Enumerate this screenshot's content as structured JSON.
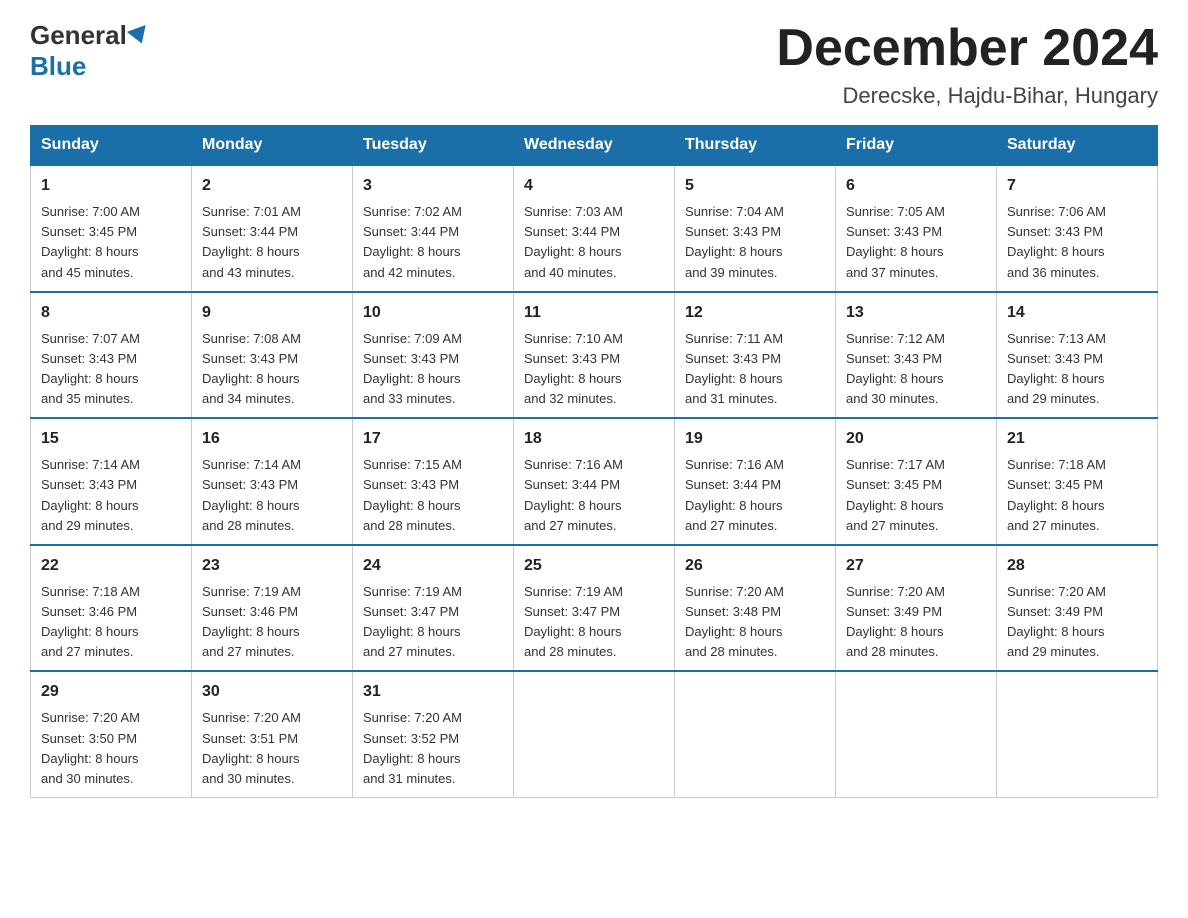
{
  "header": {
    "logo_general": "General",
    "logo_blue": "Blue",
    "title": "December 2024",
    "location": "Derecske, Hajdu-Bihar, Hungary"
  },
  "days_of_week": [
    "Sunday",
    "Monday",
    "Tuesday",
    "Wednesday",
    "Thursday",
    "Friday",
    "Saturday"
  ],
  "weeks": [
    [
      {
        "day": "1",
        "sunrise": "7:00 AM",
        "sunset": "3:45 PM",
        "daylight": "8 hours and 45 minutes."
      },
      {
        "day": "2",
        "sunrise": "7:01 AM",
        "sunset": "3:44 PM",
        "daylight": "8 hours and 43 minutes."
      },
      {
        "day": "3",
        "sunrise": "7:02 AM",
        "sunset": "3:44 PM",
        "daylight": "8 hours and 42 minutes."
      },
      {
        "day": "4",
        "sunrise": "7:03 AM",
        "sunset": "3:44 PM",
        "daylight": "8 hours and 40 minutes."
      },
      {
        "day": "5",
        "sunrise": "7:04 AM",
        "sunset": "3:43 PM",
        "daylight": "8 hours and 39 minutes."
      },
      {
        "day": "6",
        "sunrise": "7:05 AM",
        "sunset": "3:43 PM",
        "daylight": "8 hours and 37 minutes."
      },
      {
        "day": "7",
        "sunrise": "7:06 AM",
        "sunset": "3:43 PM",
        "daylight": "8 hours and 36 minutes."
      }
    ],
    [
      {
        "day": "8",
        "sunrise": "7:07 AM",
        "sunset": "3:43 PM",
        "daylight": "8 hours and 35 minutes."
      },
      {
        "day": "9",
        "sunrise": "7:08 AM",
        "sunset": "3:43 PM",
        "daylight": "8 hours and 34 minutes."
      },
      {
        "day": "10",
        "sunrise": "7:09 AM",
        "sunset": "3:43 PM",
        "daylight": "8 hours and 33 minutes."
      },
      {
        "day": "11",
        "sunrise": "7:10 AM",
        "sunset": "3:43 PM",
        "daylight": "8 hours and 32 minutes."
      },
      {
        "day": "12",
        "sunrise": "7:11 AM",
        "sunset": "3:43 PM",
        "daylight": "8 hours and 31 minutes."
      },
      {
        "day": "13",
        "sunrise": "7:12 AM",
        "sunset": "3:43 PM",
        "daylight": "8 hours and 30 minutes."
      },
      {
        "day": "14",
        "sunrise": "7:13 AM",
        "sunset": "3:43 PM",
        "daylight": "8 hours and 29 minutes."
      }
    ],
    [
      {
        "day": "15",
        "sunrise": "7:14 AM",
        "sunset": "3:43 PM",
        "daylight": "8 hours and 29 minutes."
      },
      {
        "day": "16",
        "sunrise": "7:14 AM",
        "sunset": "3:43 PM",
        "daylight": "8 hours and 28 minutes."
      },
      {
        "day": "17",
        "sunrise": "7:15 AM",
        "sunset": "3:43 PM",
        "daylight": "8 hours and 28 minutes."
      },
      {
        "day": "18",
        "sunrise": "7:16 AM",
        "sunset": "3:44 PM",
        "daylight": "8 hours and 27 minutes."
      },
      {
        "day": "19",
        "sunrise": "7:16 AM",
        "sunset": "3:44 PM",
        "daylight": "8 hours and 27 minutes."
      },
      {
        "day": "20",
        "sunrise": "7:17 AM",
        "sunset": "3:45 PM",
        "daylight": "8 hours and 27 minutes."
      },
      {
        "day": "21",
        "sunrise": "7:18 AM",
        "sunset": "3:45 PM",
        "daylight": "8 hours and 27 minutes."
      }
    ],
    [
      {
        "day": "22",
        "sunrise": "7:18 AM",
        "sunset": "3:46 PM",
        "daylight": "8 hours and 27 minutes."
      },
      {
        "day": "23",
        "sunrise": "7:19 AM",
        "sunset": "3:46 PM",
        "daylight": "8 hours and 27 minutes."
      },
      {
        "day": "24",
        "sunrise": "7:19 AM",
        "sunset": "3:47 PM",
        "daylight": "8 hours and 27 minutes."
      },
      {
        "day": "25",
        "sunrise": "7:19 AM",
        "sunset": "3:47 PM",
        "daylight": "8 hours and 28 minutes."
      },
      {
        "day": "26",
        "sunrise": "7:20 AM",
        "sunset": "3:48 PM",
        "daylight": "8 hours and 28 minutes."
      },
      {
        "day": "27",
        "sunrise": "7:20 AM",
        "sunset": "3:49 PM",
        "daylight": "8 hours and 28 minutes."
      },
      {
        "day": "28",
        "sunrise": "7:20 AM",
        "sunset": "3:49 PM",
        "daylight": "8 hours and 29 minutes."
      }
    ],
    [
      {
        "day": "29",
        "sunrise": "7:20 AM",
        "sunset": "3:50 PM",
        "daylight": "8 hours and 30 minutes."
      },
      {
        "day": "30",
        "sunrise": "7:20 AM",
        "sunset": "3:51 PM",
        "daylight": "8 hours and 30 minutes."
      },
      {
        "day": "31",
        "sunrise": "7:20 AM",
        "sunset": "3:52 PM",
        "daylight": "8 hours and 31 minutes."
      },
      null,
      null,
      null,
      null
    ]
  ],
  "labels": {
    "sunrise": "Sunrise:",
    "sunset": "Sunset:",
    "daylight": "Daylight:"
  }
}
